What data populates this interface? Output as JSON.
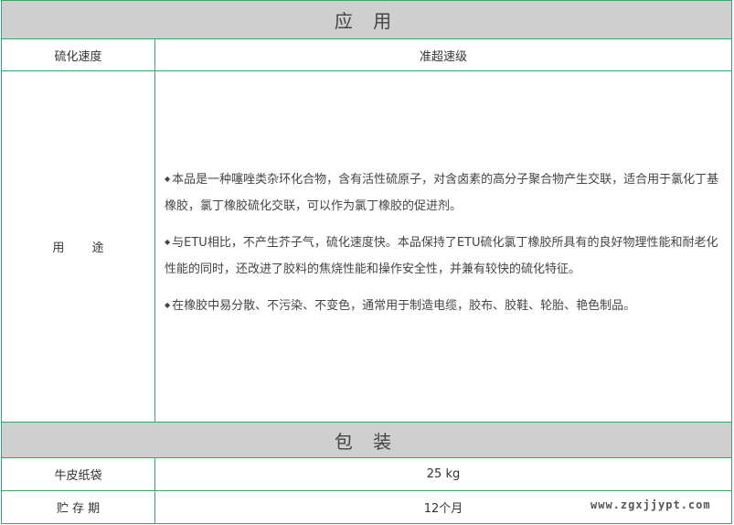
{
  "application": {
    "heading": "应 用",
    "curing_speed_label": "硫化速度",
    "curing_speed_value": "准超速级",
    "usage_label": "用 途",
    "usage_paragraphs": [
      "本品是一种噻唑类杂环化合物，含有活性硫原子，对含卤素的高分子聚合物产生交联，适合用于氯化丁基橡胶，氯丁橡胶硫化交联，可以作为氯丁橡胶的促进剂。",
      "与ETU相比，不产生芥子气，硫化速度快。本品保持了ETU硫化氯丁橡胶所具有的良好物理性能和耐老化性能的同时，还改进了胶料的焦烧性能和操作安全性，并兼有较快的硫化特征。",
      "在橡胶中易分散、不污染、不变色，通常用于制造电缆，胶布、胶鞋、轮胎、艳色制品。"
    ],
    "bullet": "◆"
  },
  "packaging": {
    "heading": "包 装",
    "bag_label": "牛皮纸袋",
    "bag_value": "25 kg",
    "storage_label": "贮 存 期",
    "storage_value": "12个月"
  },
  "watermark": "www.zgxjjypt.com",
  "colors": {
    "border": "#3aa66a",
    "header_bg": "#cfcfcf"
  }
}
